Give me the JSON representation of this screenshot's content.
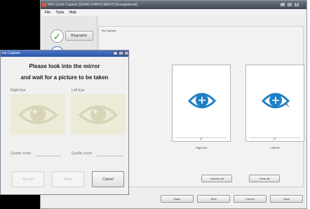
{
  "window": {
    "title": "IRIS Quick Capture [DEMO ENROLMENT] [Unregistered]",
    "menu": [
      "File",
      "Tools",
      "Help"
    ],
    "min": "_",
    "max": "□",
    "close": "X"
  },
  "nav": {
    "biographic_label": "Biographic"
  },
  "content": {
    "section_title": "Iris Capture",
    "right_eye_label": "Right iris",
    "left_eye_label": "Left iris",
    "capture_all": "Capture all",
    "clear_all": "Clear all",
    "back": "Back",
    "next": "Next",
    "cancel": "Cancel",
    "save": "Save"
  },
  "dialog": {
    "title": "Iris Capture",
    "instruction_line1": "Please look into the mirror",
    "instruction_line2": "and wait for a picture to be taken",
    "right_eye": "Right Eye",
    "left_eye": "Left Eye",
    "quality_score_label": "Quality score",
    "accept": "Accept",
    "retry": "Retry",
    "cancel": "Cancel",
    "min": "_",
    "max": "□",
    "close": "X"
  },
  "colors": {
    "eye_blue": "#1f7fc4",
    "check_green": "#3ca53c",
    "pale_eye": "#ecebd7",
    "pale_eye_stroke": "#d7d4b7"
  }
}
